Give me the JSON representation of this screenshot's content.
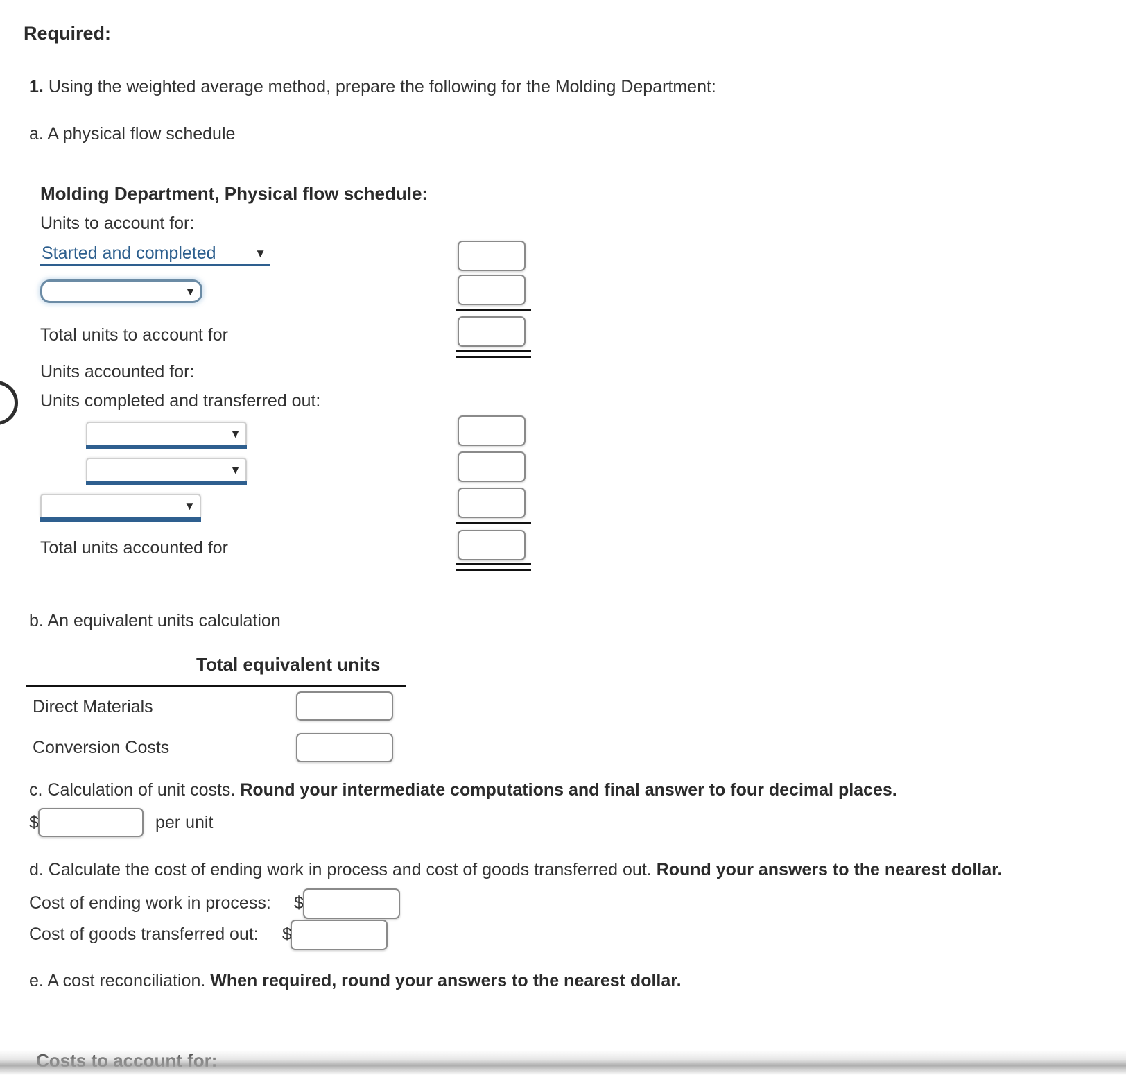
{
  "heading": "Required:",
  "instruction": {
    "number": "1.",
    "text": "Using the weighted average method, prepare the following for the Molding Department:"
  },
  "part_a": {
    "label": "a. A physical flow schedule",
    "schedule_title": "Molding Department, Physical flow schedule:",
    "units_to_account_label": "Units to account for:",
    "rows_to_account": [
      {
        "select_value": "Started and completed",
        "box_value": ""
      },
      {
        "select_value": "",
        "box_value": ""
      }
    ],
    "total_to_account_label": "Total units to account for",
    "total_to_account_value": "",
    "units_accounted_label": "Units accounted for:",
    "completed_transferred_label": "Units completed and transferred out:",
    "rows_accounted": [
      {
        "select_value": "",
        "box_value": ""
      },
      {
        "select_value": "",
        "box_value": ""
      },
      {
        "select_value": "",
        "box_value": ""
      }
    ],
    "total_accounted_label": "Total units accounted for",
    "total_accounted_value": ""
  },
  "part_b": {
    "label": "b. An equivalent units calculation",
    "column_header": "Total equivalent units",
    "rows": [
      {
        "label": "Direct Materials",
        "value": ""
      },
      {
        "label": "Conversion Costs",
        "value": ""
      }
    ]
  },
  "part_c": {
    "label_plain": "c. Calculation of unit costs.",
    "label_bold": "Round your intermediate computations and final answer to four decimal places.",
    "currency": "$",
    "value": "",
    "suffix": "per unit"
  },
  "part_d": {
    "label_plain": "d. Calculate the cost of ending work in process and cost of goods transferred out.",
    "label_bold": "Round your answers to the nearest dollar.",
    "rows": [
      {
        "label": "Cost of ending work in process:",
        "currency": "$",
        "value": ""
      },
      {
        "label": "Cost of goods transferred out:",
        "currency": "$",
        "value": ""
      }
    ]
  },
  "part_e": {
    "label_plain": "e. A cost reconciliation.",
    "label_bold": "When required, round your answers to the nearest dollar.",
    "clipped_heading": "Costs to account for:"
  },
  "icons": {
    "caret": "▼"
  },
  "colors": {
    "select_accent": "#2e5f8f",
    "select_focus_border": "#6b8ba5",
    "box_border": "#8a8a8a",
    "text": "#333333"
  }
}
